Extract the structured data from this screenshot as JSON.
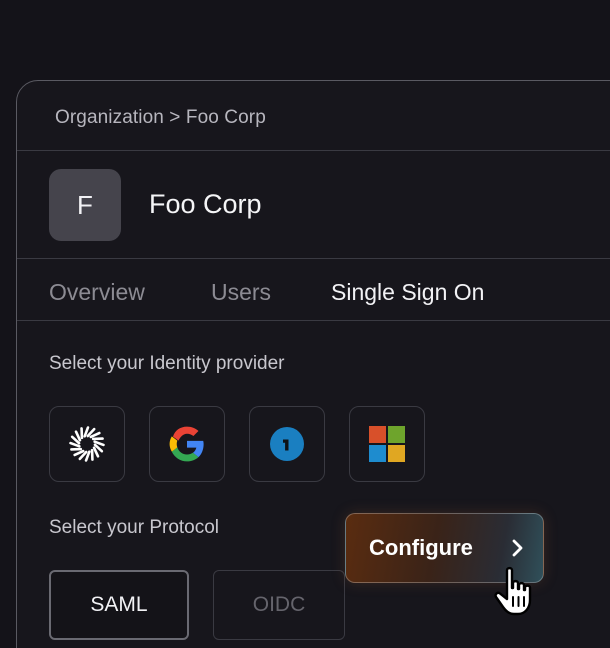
{
  "breadcrumb": {
    "text": "Organization > Foo Corp"
  },
  "organization": {
    "avatar_letter": "F",
    "name": "Foo Corp"
  },
  "tabs": [
    {
      "label": "Overview",
      "active": false
    },
    {
      "label": "Users",
      "active": false
    },
    {
      "label": "Single Sign On",
      "active": true
    }
  ],
  "identity_section": {
    "label": "Select your Identity provider"
  },
  "identity_providers": [
    {
      "icon": "okta-icon"
    },
    {
      "icon": "google-icon"
    },
    {
      "icon": "onelogin-icon"
    },
    {
      "icon": "microsoft-icon"
    }
  ],
  "protocol_section": {
    "label": "Select your Protocol"
  },
  "protocols": [
    {
      "label": "SAML",
      "selected": true
    },
    {
      "label": "OIDC",
      "selected": false
    }
  ],
  "configure_button": {
    "label": "Configure",
    "icon": "chevron-right-icon"
  },
  "colors": {
    "background": "#141319",
    "panel_border": "#5a5a62",
    "text_primary": "#f5f5f7",
    "text_muted": "#8c8b93",
    "google_blue": "#4285F4",
    "google_red": "#EA4335",
    "google_yellow": "#FBBC05",
    "google_green": "#34A853",
    "onelogin_blue": "#1a7fc1",
    "ms_red": "#f25022",
    "ms_green": "#7fba00",
    "ms_blue": "#00a4ef",
    "ms_yellow": "#ffb900"
  }
}
